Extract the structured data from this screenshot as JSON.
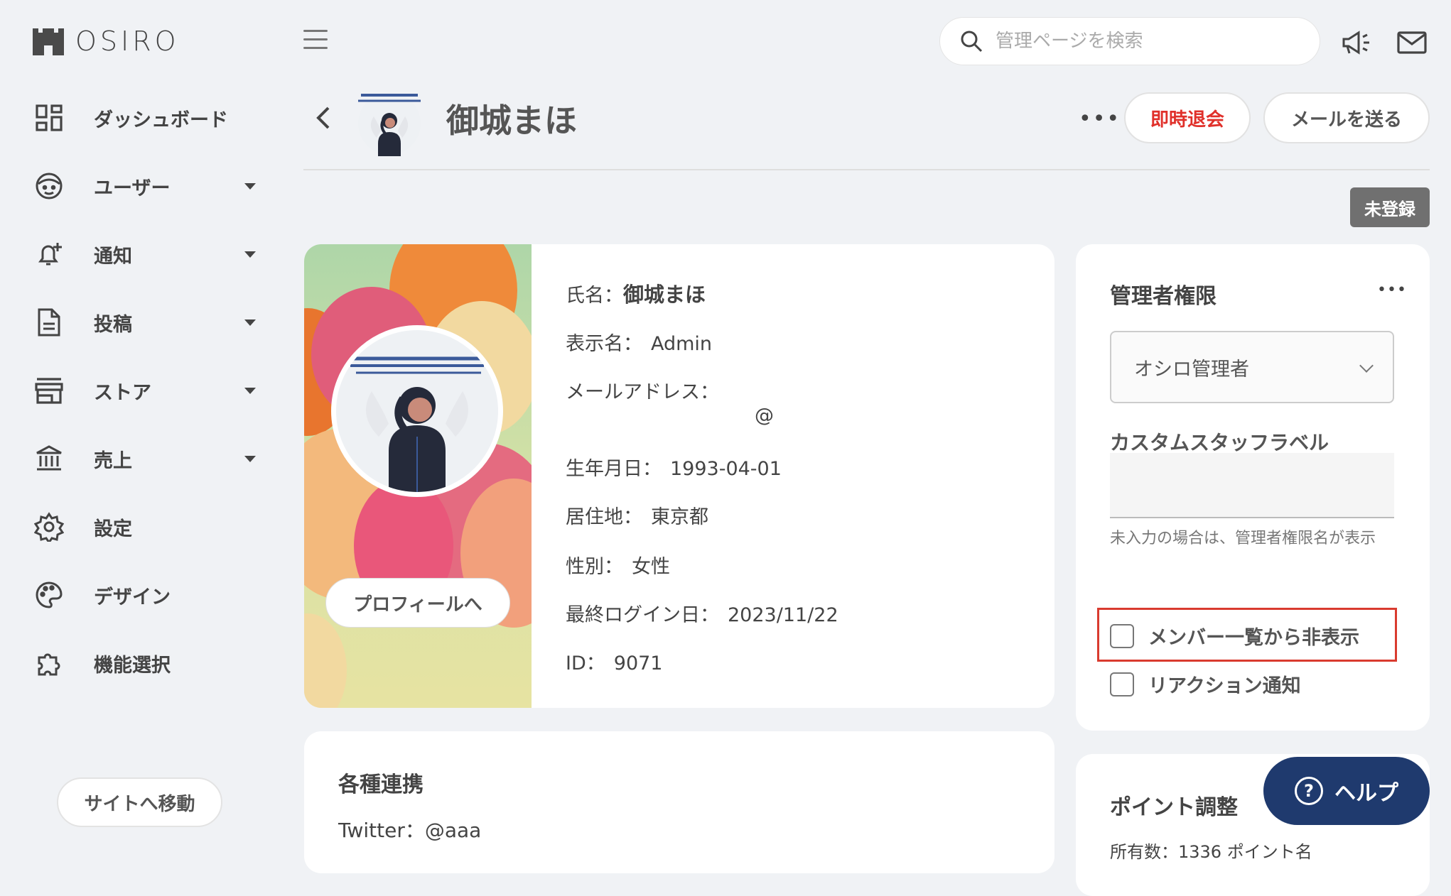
{
  "brand": {
    "name": "OSIRO"
  },
  "sidebar": {
    "items": [
      {
        "label": "ダッシュボード",
        "icon": "dashboard-icon",
        "has_caret": false
      },
      {
        "label": "ユーザー",
        "icon": "user-face-icon",
        "has_caret": true
      },
      {
        "label": "通知",
        "icon": "bell-plus-icon",
        "has_caret": true
      },
      {
        "label": "投稿",
        "icon": "document-icon",
        "has_caret": true
      },
      {
        "label": "ストア",
        "icon": "store-icon",
        "has_caret": true
      },
      {
        "label": "売上",
        "icon": "bank-icon",
        "has_caret": true
      },
      {
        "label": "設定",
        "icon": "gear-icon",
        "has_caret": false
      },
      {
        "label": "デザイン",
        "icon": "palette-icon",
        "has_caret": false
      },
      {
        "label": "機能選択",
        "icon": "puzzle-icon",
        "has_caret": false
      }
    ],
    "site_button": "サイトへ移動"
  },
  "topbar": {
    "search_placeholder": "管理ページを検索"
  },
  "header": {
    "title": "御城まほ",
    "withdraw_button": "即時退会",
    "mail_button": "メールを送る",
    "status_badge": "未登録"
  },
  "profile": {
    "profile_button": "プロフィールへ",
    "name_label": "氏名：",
    "name_value": "御城まほ",
    "display_name_label": "表示名：",
    "display_name_value": "Admin",
    "email_label": "メールアドレス：",
    "email_value": "@",
    "birthday_label": "生年月日：",
    "birthday_value": "1993-04-01",
    "residence_label": "居住地：",
    "residence_value": "東京都",
    "gender_label": "性別：",
    "gender_value": "女性",
    "last_login_label": "最終ログイン日：",
    "last_login_value": "2023/11/22",
    "id_label": "ID：",
    "id_value": "9071"
  },
  "integrations": {
    "title": "各種連携",
    "twitter": "Twitter：@aaa"
  },
  "admin": {
    "title": "管理者権限",
    "role_selected": "オシロ管理者",
    "custom_label_title": "カスタムスタッフラベル",
    "custom_label_value": "",
    "custom_label_help": "未入力の場合は、管理者権限名が表示",
    "hide_from_members": "メンバー一覧から非表示",
    "reaction_notify": "リアクション通知",
    "highlight_color": "#d93b2f"
  },
  "points": {
    "title": "ポイント調整",
    "subtitle": "所有数：1336 ポイント名"
  },
  "help": {
    "label": "ヘルプ"
  },
  "colors": {
    "danger": "#e0302a",
    "help_bg": "#1f3a6e",
    "badge_bg": "#707070"
  }
}
